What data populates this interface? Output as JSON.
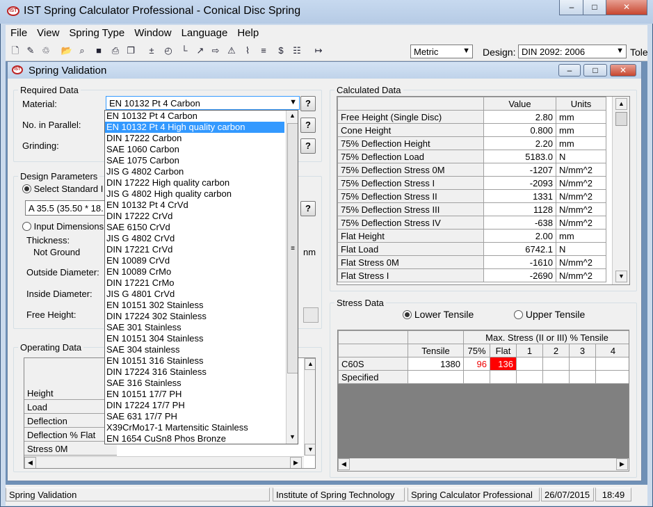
{
  "app": {
    "title": "IST Spring Calculator Professional - Conical Disc Spring",
    "icon": "ist-logo-icon"
  },
  "menu": [
    "File",
    "View",
    "Spring Type",
    "Window",
    "Language",
    "Help"
  ],
  "toolbar": {
    "units": "Metric",
    "design_label": "Design:",
    "design_value": "DIN 2092: 2006",
    "tole_label": "Tole"
  },
  "child": {
    "title": "Spring Validation"
  },
  "required": {
    "heading": "Required Data",
    "material_label": "Material:",
    "material_value": "EN 10132 Pt 4 Carbon",
    "parallel_label": "No. in Parallel:",
    "grinding_label": "Grinding:",
    "help": "?"
  },
  "material_options": [
    "EN 10132 Pt 4 Carbon",
    "EN 10132 Pt 4 High quality carbon",
    "DIN 17222 Carbon",
    "SAE 1060 Carbon",
    "SAE 1075 Carbon",
    "JIS G 4802 Carbon",
    "DIN 17222 High quality carbon",
    "JIS G 4802 High quality carbon",
    "EN 10132 Pt 4 CrVd",
    "DIN 17222 CrVd",
    "SAE 6150 CrVd",
    "JIS G 4802 CrVd",
    "DIN 17221 CrVd",
    "EN 10089 CrVd",
    "EN 10089 CrMo",
    "DIN 17221 CrMo",
    "JIS G 4801 CrVd",
    "EN 10151 302 Stainless",
    "DIN 17224 302 Stainless",
    "SAE 301 Stainless",
    "EN 10151 304 Stainless",
    "SAE 304 stainless",
    "EN 10151 316 Stainless",
    "DIN 17224 316 Stainless",
    "SAE 316 Stainless",
    "EN 10151 17/7 PH",
    "DIN 17224 17/7 PH",
    "SAE 631 17/7 PH",
    "X39CrMo17-1 Martensitic Stainless",
    "EN 1654 CuSn8 Phos Bronze"
  ],
  "material_selected_index": 1,
  "design": {
    "heading": "Design Parameters",
    "select_standard": "Select Standard I",
    "standard_value": "A 35.5   (35.50 * 18.",
    "input_dimensions": "Input Dimensions",
    "thickness_label": "Thickness:",
    "not_ground": "Not Ground",
    "unit_mm": "nm",
    "outside_label": "Outside Diameter:",
    "inside_label": "Inside Diameter:",
    "free_height_label": "Free Height:"
  },
  "operating": {
    "heading": "Operating Data",
    "rows": [
      "Height",
      "Load",
      "Deflection",
      "Deflection % Flat",
      "Stress 0M"
    ]
  },
  "calculated": {
    "heading": "Calculated Data",
    "col_value": "Value",
    "col_units": "Units",
    "rows": [
      {
        "name": "Free Height (Single Disc)",
        "value": "2.80",
        "units": "mm"
      },
      {
        "name": "Cone Height",
        "value": "0.800",
        "units": "mm"
      },
      {
        "name": "75% Deflection Height",
        "value": "2.20",
        "units": "mm"
      },
      {
        "name": "75% Deflection Load",
        "value": "5183.0",
        "units": "N"
      },
      {
        "name": "75% Deflection Stress 0M",
        "value": "-1207",
        "units": "N/mm^2"
      },
      {
        "name": "75% Deflection Stress I",
        "value": "-2093",
        "units": "N/mm^2"
      },
      {
        "name": "75% Deflection Stress II",
        "value": "1331",
        "units": "N/mm^2"
      },
      {
        "name": "75% Deflection Stress III",
        "value": "1128",
        "units": "N/mm^2"
      },
      {
        "name": "75% Deflection Stress IV",
        "value": "-638",
        "units": "N/mm^2"
      },
      {
        "name": "Flat Height",
        "value": "2.00",
        "units": "mm"
      },
      {
        "name": "Flat Load",
        "value": "6742.1",
        "units": "N"
      },
      {
        "name": "Flat Stress 0M",
        "value": "-1610",
        "units": "N/mm^2"
      },
      {
        "name": "Flat Stress I",
        "value": "-2690",
        "units": "N/mm^2"
      }
    ]
  },
  "stress": {
    "heading": "Stress Data",
    "lower": "Lower Tensile",
    "upper": "Upper Tensile",
    "max_header": "Max. Stress (II or III) % Tensile",
    "cols": [
      "Tensile",
      "75%",
      "Flat",
      "1",
      "2",
      "3",
      "4"
    ],
    "rows": [
      {
        "name": "C60S",
        "tensile": "1380",
        "p75": "96",
        "flat": "136"
      },
      {
        "name": "Specified",
        "tensile": "",
        "p75": "",
        "flat": ""
      }
    ],
    "highlight_color": "#ff0000"
  },
  "status": {
    "panel1": "Spring Validation",
    "panel2": "Institute of Spring Technology",
    "panel3": "Spring Calculator Professional",
    "date": "26/07/2015",
    "time": "18:49"
  }
}
